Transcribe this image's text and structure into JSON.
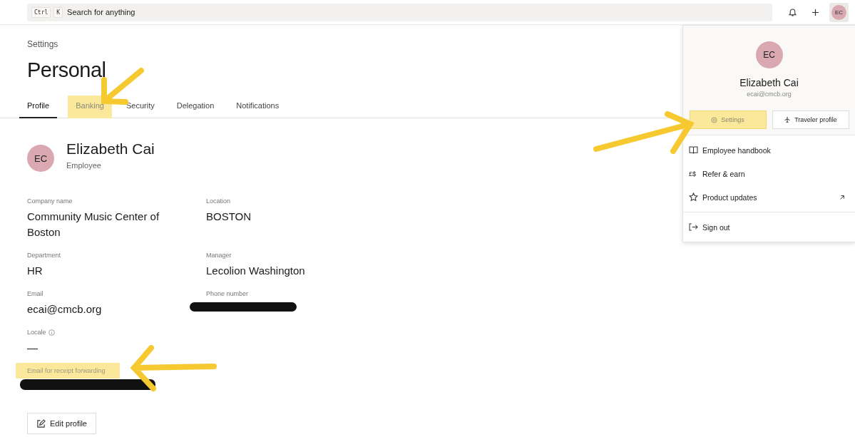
{
  "top_bar": {
    "search": {
      "keys": [
        "Ctrl",
        "K"
      ],
      "placeholder": "Search for anything"
    },
    "avatar": "EC"
  },
  "breadcrumb": "Settings",
  "title": "Personal",
  "tabs": [
    {
      "label": "Profile",
      "selected": true,
      "highlighted": false
    },
    {
      "label": "Banking",
      "selected": false,
      "highlighted": true
    },
    {
      "label": "Security",
      "selected": false,
      "highlighted": false
    },
    {
      "label": "Delegation",
      "selected": false,
      "highlighted": false
    },
    {
      "label": "Notifications",
      "selected": false,
      "highlighted": false
    }
  ],
  "profile": {
    "avatar": "EC",
    "name": "Elizabeth Cai",
    "role": "Employee"
  },
  "field_rows": [
    [
      {
        "label": "Company name",
        "value": "Community Music Center of Boston",
        "highlighted": false
      },
      {
        "label": "Location",
        "value": "BOSTON",
        "highlighted": false
      }
    ],
    [
      {
        "label": "Department",
        "value": "HR",
        "highlighted": false
      },
      {
        "label": "Manager",
        "value": "Lecolion Washington",
        "highlighted": false
      }
    ],
    [
      {
        "label": "Email",
        "value": "ecai@cmcb.org",
        "highlighted": false
      },
      {
        "label": "Phone number",
        "highlighted": false,
        "redacted": true
      }
    ],
    [
      {
        "label": "Locale",
        "value": "—",
        "info": true,
        "highlighted": false
      }
    ],
    [
      {
        "label": "Email for receipt forwarding",
        "highlighted": true,
        "redacted": true
      }
    ]
  ],
  "edit_button": "Edit profile",
  "account_menu": {
    "avatar": "EC",
    "name": "Elizabeth Cai",
    "email": "ecai@cmcb.org",
    "buttons": [
      {
        "label": "Settings",
        "kind": "gear",
        "highlighted": true
      },
      {
        "label": "Traveler profile",
        "kind": "plane",
        "highlighted": false
      }
    ],
    "items": [
      {
        "label": "Employee handbook",
        "kind": "book"
      },
      {
        "label": "Refer & earn",
        "kind": "glyph",
        "glyph": "£$"
      },
      {
        "label": "Product updates",
        "kind": "star",
        "external": true
      }
    ],
    "sign_out": "Sign out"
  }
}
